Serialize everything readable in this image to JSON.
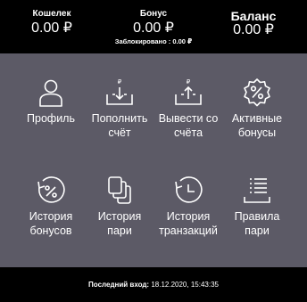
{
  "balances": {
    "wallet": {
      "label": "Кошелек",
      "value": "0.00 ₽"
    },
    "bonus": {
      "label": "Бонус",
      "value": "0.00 ₽",
      "blocked_text": "Заблокировано : 0.00 ₽"
    },
    "total": {
      "label": "Баланс",
      "value": "0.00 ₽"
    }
  },
  "menu": {
    "items": [
      {
        "label_line1": "Профиль",
        "label_line2": "",
        "icon": "user-icon"
      },
      {
        "label_line1": "Пополнить",
        "label_line2": "счёт",
        "icon": "deposit-icon"
      },
      {
        "label_line1": "Вывести со",
        "label_line2": "счёта",
        "icon": "withdraw-icon"
      },
      {
        "label_line1": "Активные",
        "label_line2": "бонусы",
        "icon": "percent-badge-icon"
      },
      {
        "label_line1": "История",
        "label_line2": "бонусов",
        "icon": "bonus-history-icon"
      },
      {
        "label_line1": "История",
        "label_line2": "пари",
        "icon": "cards-icon"
      },
      {
        "label_line1": "История",
        "label_line2": "транзакций",
        "icon": "clock-history-icon"
      },
      {
        "label_line1": "Правила",
        "label_line2": "пари",
        "icon": "rules-list-icon"
      }
    ]
  },
  "footer": {
    "last_login_label": "Последний вход:",
    "last_login_value": "18.12.2020, 15:43:35"
  },
  "colors": {
    "menu_background": "#5c5a66",
    "bar_background": "#000000",
    "text": "#ffffff"
  }
}
